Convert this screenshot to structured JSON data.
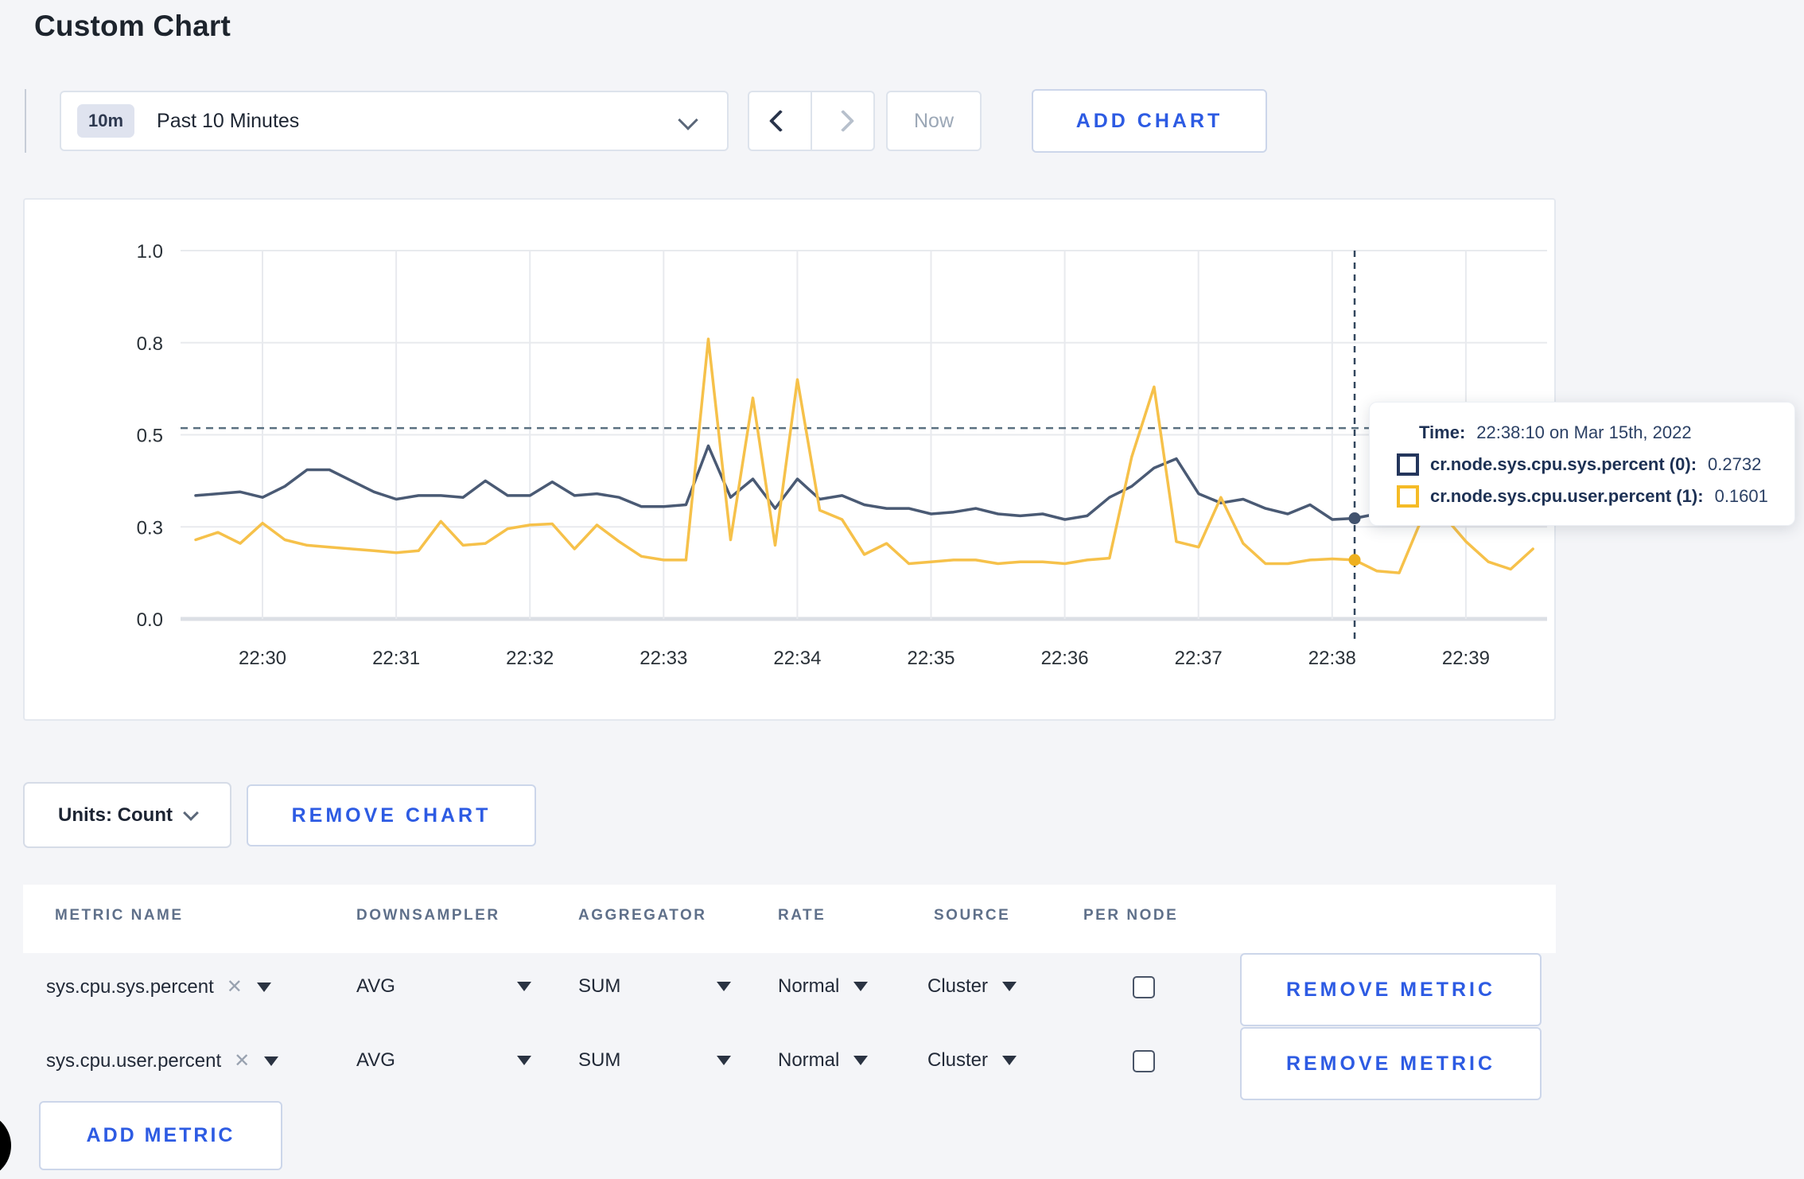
{
  "page": {
    "title": "Custom Chart",
    "background": "#f4f5f8",
    "accent_blue": "#2d5be3"
  },
  "toolbar": {
    "time_window_badge": "10m",
    "time_window_label": "Past 10 Minutes",
    "now_label": "Now",
    "add_chart_label": "ADD CHART"
  },
  "tooltip": {
    "time_label": "Time:",
    "time_value": "22:38:10 on Mar 15th, 2022",
    "series": [
      {
        "name": "cr.node.sys.cpu.sys.percent (0):",
        "value": "0.2732",
        "color": "#24365c"
      },
      {
        "name": "cr.node.sys.cpu.user.percent (1):",
        "value": "0.1601",
        "color": "#f5bb26"
      }
    ]
  },
  "units_row": {
    "units_label": "Units: Count",
    "remove_chart_label": "REMOVE CHART"
  },
  "table": {
    "headers": [
      "METRIC NAME",
      "DOWNSAMPLER",
      "AGGREGATOR",
      "RATE",
      "SOURCE",
      "PER NODE"
    ],
    "rows": [
      {
        "metric": "sys.cpu.sys.percent",
        "downsampler": "AVG",
        "aggregator": "SUM",
        "rate": "Normal",
        "source": "Cluster",
        "per_node_checked": false,
        "remove_label": "REMOVE METRIC"
      },
      {
        "metric": "sys.cpu.user.percent",
        "downsampler": "AVG",
        "aggregator": "SUM",
        "rate": "Normal",
        "source": "Cluster",
        "per_node_checked": false,
        "remove_label": "REMOVE METRIC"
      }
    ],
    "add_metric_label": "ADD METRIC"
  },
  "chart_data": {
    "type": "line",
    "title": "",
    "xlabel": "",
    "ylabel": "",
    "ylim": [
      0,
      1
    ],
    "grid": true,
    "x_ticks": [
      "22:30",
      "22:31",
      "22:32",
      "22:33",
      "22:34",
      "22:35",
      "22:36",
      "22:37",
      "22:38",
      "22:39"
    ],
    "y_tick_labels": [
      "0.0",
      "0.3",
      "0.5",
      "0.8",
      "1.0"
    ],
    "y_tick_values": [
      0,
      0.25,
      0.5,
      0.75,
      1.0
    ],
    "start_time": "22:29:30",
    "interval_seconds": 10,
    "series": [
      {
        "name": "cr.node.sys.cpu.sys.percent",
        "color": "#4a5a74",
        "values": [
          0.335,
          0.34,
          0.345,
          0.33,
          0.36,
          0.405,
          0.405,
          0.375,
          0.345,
          0.325,
          0.335,
          0.335,
          0.33,
          0.375,
          0.335,
          0.335,
          0.372,
          0.335,
          0.34,
          0.33,
          0.305,
          0.305,
          0.31,
          0.47,
          0.33,
          0.38,
          0.3,
          0.38,
          0.325,
          0.335,
          0.31,
          0.3,
          0.3,
          0.285,
          0.29,
          0.3,
          0.285,
          0.28,
          0.285,
          0.27,
          0.28,
          0.33,
          0.36,
          0.41,
          0.435,
          0.34,
          0.315,
          0.325,
          0.3,
          0.285,
          0.31,
          0.27,
          0.2732,
          0.285,
          0.295,
          0.3,
          0.295,
          0.3,
          0.3,
          0.295,
          0.3
        ]
      },
      {
        "name": "cr.node.sys.cpu.user.percent",
        "color": "#f6c14a",
        "values": [
          0.215,
          0.235,
          0.205,
          0.26,
          0.215,
          0.2,
          0.195,
          0.19,
          0.185,
          0.18,
          0.185,
          0.265,
          0.2,
          0.205,
          0.245,
          0.255,
          0.258,
          0.19,
          0.255,
          0.21,
          0.17,
          0.16,
          0.16,
          0.76,
          0.215,
          0.6,
          0.2,
          0.65,
          0.295,
          0.27,
          0.175,
          0.205,
          0.15,
          0.155,
          0.16,
          0.16,
          0.15,
          0.155,
          0.155,
          0.15,
          0.16,
          0.165,
          0.44,
          0.63,
          0.21,
          0.195,
          0.33,
          0.205,
          0.15,
          0.15,
          0.16,
          0.163,
          0.1601,
          0.13,
          0.125,
          0.27,
          0.28,
          0.21,
          0.155,
          0.135,
          0.19
        ]
      }
    ],
    "guideline_y": 0.518,
    "crosshair": {
      "time": "22:38:10",
      "index": 52,
      "values": [
        0.2732,
        0.1601
      ],
      "dot_colors": [
        "#42536e",
        "#eeb01f"
      ]
    },
    "legend_position": "tooltip"
  }
}
